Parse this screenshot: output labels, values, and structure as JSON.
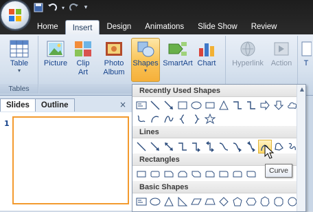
{
  "tabs": [
    "Home",
    "Insert",
    "Design",
    "Animations",
    "Slide Show",
    "Review"
  ],
  "active_tab": "Insert",
  "ribbon": {
    "tables": {
      "label": "Tables",
      "table_button": "Table"
    },
    "illustrations": {
      "label": "Illustra",
      "picture": "Picture",
      "clip_art": [
        "Clip",
        "Art"
      ],
      "photo_album": [
        "Photo",
        "Album"
      ],
      "shapes": "Shapes",
      "smartart": "SmartArt",
      "chart": "Chart"
    },
    "links": {
      "hyperlink": "Hyperlink",
      "action": "Action"
    },
    "partial_next": "T"
  },
  "left_pane": {
    "tabs": [
      "Slides",
      "Outline"
    ],
    "close": "×",
    "slide_number": "1"
  },
  "gallery": {
    "sections": [
      {
        "title": "Recently Used Shapes"
      },
      {
        "title": "Lines"
      },
      {
        "title": "Rectangles"
      },
      {
        "title": "Basic Shapes"
      }
    ],
    "hovered_shape": "Curve"
  },
  "tooltip": "Curve",
  "colors": {
    "title_bar": "#1d1d1d",
    "ribbon_bg": "#d6e1ee",
    "highlight": "#f9c55a",
    "slide_border": "#f39a2e",
    "shape_stroke": "#2f4f7f"
  }
}
